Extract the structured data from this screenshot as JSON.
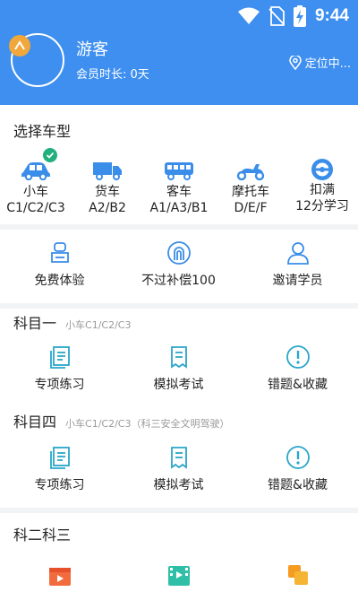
{
  "status": {
    "time": "9:44"
  },
  "profile": {
    "name": "游客",
    "member_time": "会员时长: 0天",
    "location": "定位中..."
  },
  "car_section": {
    "title": "选择车型",
    "vehicles": [
      {
        "name": "小车",
        "classes": "C1/C2/C3",
        "selected": true
      },
      {
        "name": "货车",
        "classes": "A2/B2"
      },
      {
        "name": "客车",
        "classes": "A1/A3/B1"
      },
      {
        "name": "摩托车",
        "classes": "D/E/F"
      },
      {
        "name": "扣满",
        "classes": "12分学习"
      }
    ]
  },
  "perks": {
    "items": [
      "免费体验",
      "不过补偿100",
      "邀请学员"
    ]
  },
  "subject1": {
    "title": "科目一",
    "subtitle": "小车C1/C2/C3",
    "items": [
      "专项练习",
      "模拟考试",
      "错题&收藏"
    ]
  },
  "subject4": {
    "title": "科目四",
    "subtitle": "小车C1/C2/C3（科三安全文明驾驶）",
    "items": [
      "专项练习",
      "模拟考试",
      "错题&收藏"
    ]
  },
  "subject23": {
    "title": "科二科三"
  },
  "colors": {
    "header": "#3e8ff0",
    "icon_blue": "#3a8de8",
    "teal": "#2aa6c9",
    "check": "#22b07d",
    "badge": "#f1a73a"
  }
}
